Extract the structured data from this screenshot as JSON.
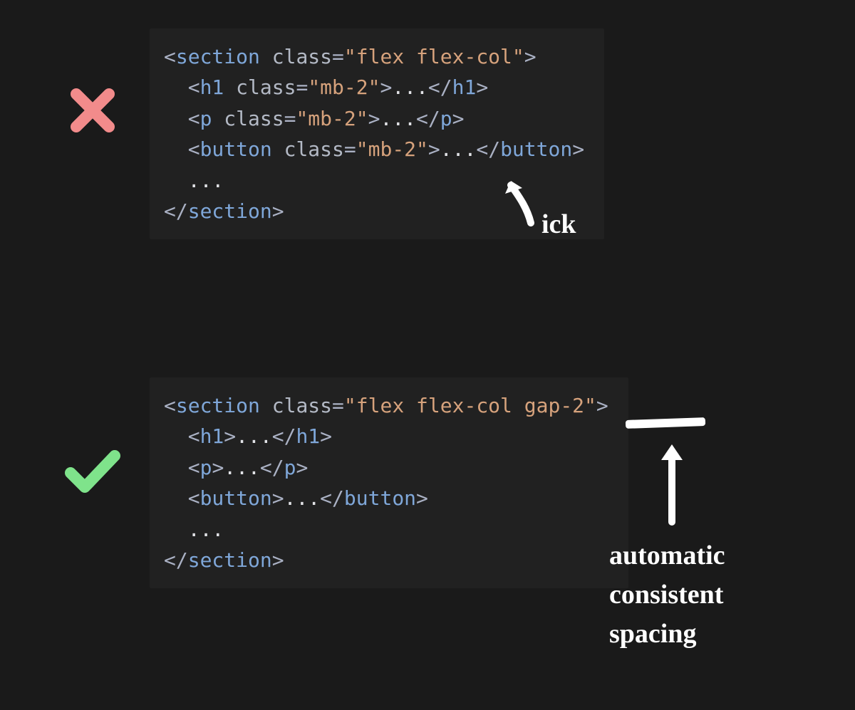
{
  "examples": {
    "bad": {
      "mark": "cross",
      "mark_color": "#f28b8b",
      "annotation_label": "ick",
      "code": [
        [
          {
            "t": "<",
            "c": "punct"
          },
          {
            "t": "section",
            "c": "tag"
          },
          {
            "t": " ",
            "c": "plain"
          },
          {
            "t": "class",
            "c": "attr"
          },
          {
            "t": "=",
            "c": "punct"
          },
          {
            "t": "\"flex flex-col\"",
            "c": "str"
          },
          {
            "t": ">",
            "c": "punct"
          }
        ],
        [
          {
            "t": "  ",
            "c": "plain"
          },
          {
            "t": "<",
            "c": "punct"
          },
          {
            "t": "h1",
            "c": "tag"
          },
          {
            "t": " ",
            "c": "plain"
          },
          {
            "t": "class",
            "c": "attr"
          },
          {
            "t": "=",
            "c": "punct"
          },
          {
            "t": "\"mb-2\"",
            "c": "str"
          },
          {
            "t": ">",
            "c": "punct"
          },
          {
            "t": "...",
            "c": "plain"
          },
          {
            "t": "</",
            "c": "punct"
          },
          {
            "t": "h1",
            "c": "tag"
          },
          {
            "t": ">",
            "c": "punct"
          }
        ],
        [
          {
            "t": "  ",
            "c": "plain"
          },
          {
            "t": "<",
            "c": "punct"
          },
          {
            "t": "p",
            "c": "tag"
          },
          {
            "t": " ",
            "c": "plain"
          },
          {
            "t": "class",
            "c": "attr"
          },
          {
            "t": "=",
            "c": "punct"
          },
          {
            "t": "\"mb-2\"",
            "c": "str"
          },
          {
            "t": ">",
            "c": "punct"
          },
          {
            "t": "...",
            "c": "plain"
          },
          {
            "t": "</",
            "c": "punct"
          },
          {
            "t": "p",
            "c": "tag"
          },
          {
            "t": ">",
            "c": "punct"
          }
        ],
        [
          {
            "t": "  ",
            "c": "plain"
          },
          {
            "t": "<",
            "c": "punct"
          },
          {
            "t": "button",
            "c": "tag"
          },
          {
            "t": " ",
            "c": "plain"
          },
          {
            "t": "class",
            "c": "attr"
          },
          {
            "t": "=",
            "c": "punct"
          },
          {
            "t": "\"mb-2\"",
            "c": "str"
          },
          {
            "t": ">",
            "c": "punct"
          },
          {
            "t": "...",
            "c": "plain"
          },
          {
            "t": "</",
            "c": "punct"
          },
          {
            "t": "button",
            "c": "tag"
          },
          {
            "t": ">",
            "c": "punct"
          }
        ],
        [
          {
            "t": "  ...",
            "c": "plain"
          }
        ],
        [
          {
            "t": "</",
            "c": "punct"
          },
          {
            "t": "section",
            "c": "tag"
          },
          {
            "t": ">",
            "c": "punct"
          }
        ]
      ]
    },
    "good": {
      "mark": "check",
      "mark_color": "#7fe38b",
      "annotation_lines": [
        "automatic",
        "consistent",
        "spacing"
      ],
      "code": [
        [
          {
            "t": "<",
            "c": "punct"
          },
          {
            "t": "section",
            "c": "tag"
          },
          {
            "t": " ",
            "c": "plain"
          },
          {
            "t": "class",
            "c": "attr"
          },
          {
            "t": "=",
            "c": "punct"
          },
          {
            "t": "\"flex flex-col gap-2\"",
            "c": "str"
          },
          {
            "t": ">",
            "c": "punct"
          }
        ],
        [
          {
            "t": "  ",
            "c": "plain"
          },
          {
            "t": "<",
            "c": "punct"
          },
          {
            "t": "h1",
            "c": "tag"
          },
          {
            "t": ">",
            "c": "punct"
          },
          {
            "t": "...",
            "c": "plain"
          },
          {
            "t": "</",
            "c": "punct"
          },
          {
            "t": "h1",
            "c": "tag"
          },
          {
            "t": ">",
            "c": "punct"
          }
        ],
        [
          {
            "t": "  ",
            "c": "plain"
          },
          {
            "t": "<",
            "c": "punct"
          },
          {
            "t": "p",
            "c": "tag"
          },
          {
            "t": ">",
            "c": "punct"
          },
          {
            "t": "...",
            "c": "plain"
          },
          {
            "t": "</",
            "c": "punct"
          },
          {
            "t": "p",
            "c": "tag"
          },
          {
            "t": ">",
            "c": "punct"
          }
        ],
        [
          {
            "t": "  ",
            "c": "plain"
          },
          {
            "t": "<",
            "c": "punct"
          },
          {
            "t": "button",
            "c": "tag"
          },
          {
            "t": ">",
            "c": "punct"
          },
          {
            "t": "...",
            "c": "plain"
          },
          {
            "t": "</",
            "c": "punct"
          },
          {
            "t": "button",
            "c": "tag"
          },
          {
            "t": ">",
            "c": "punct"
          }
        ],
        [
          {
            "t": "  ...",
            "c": "plain"
          }
        ],
        [
          {
            "t": "</",
            "c": "punct"
          },
          {
            "t": "section",
            "c": "tag"
          },
          {
            "t": ">",
            "c": "punct"
          }
        ]
      ]
    }
  }
}
